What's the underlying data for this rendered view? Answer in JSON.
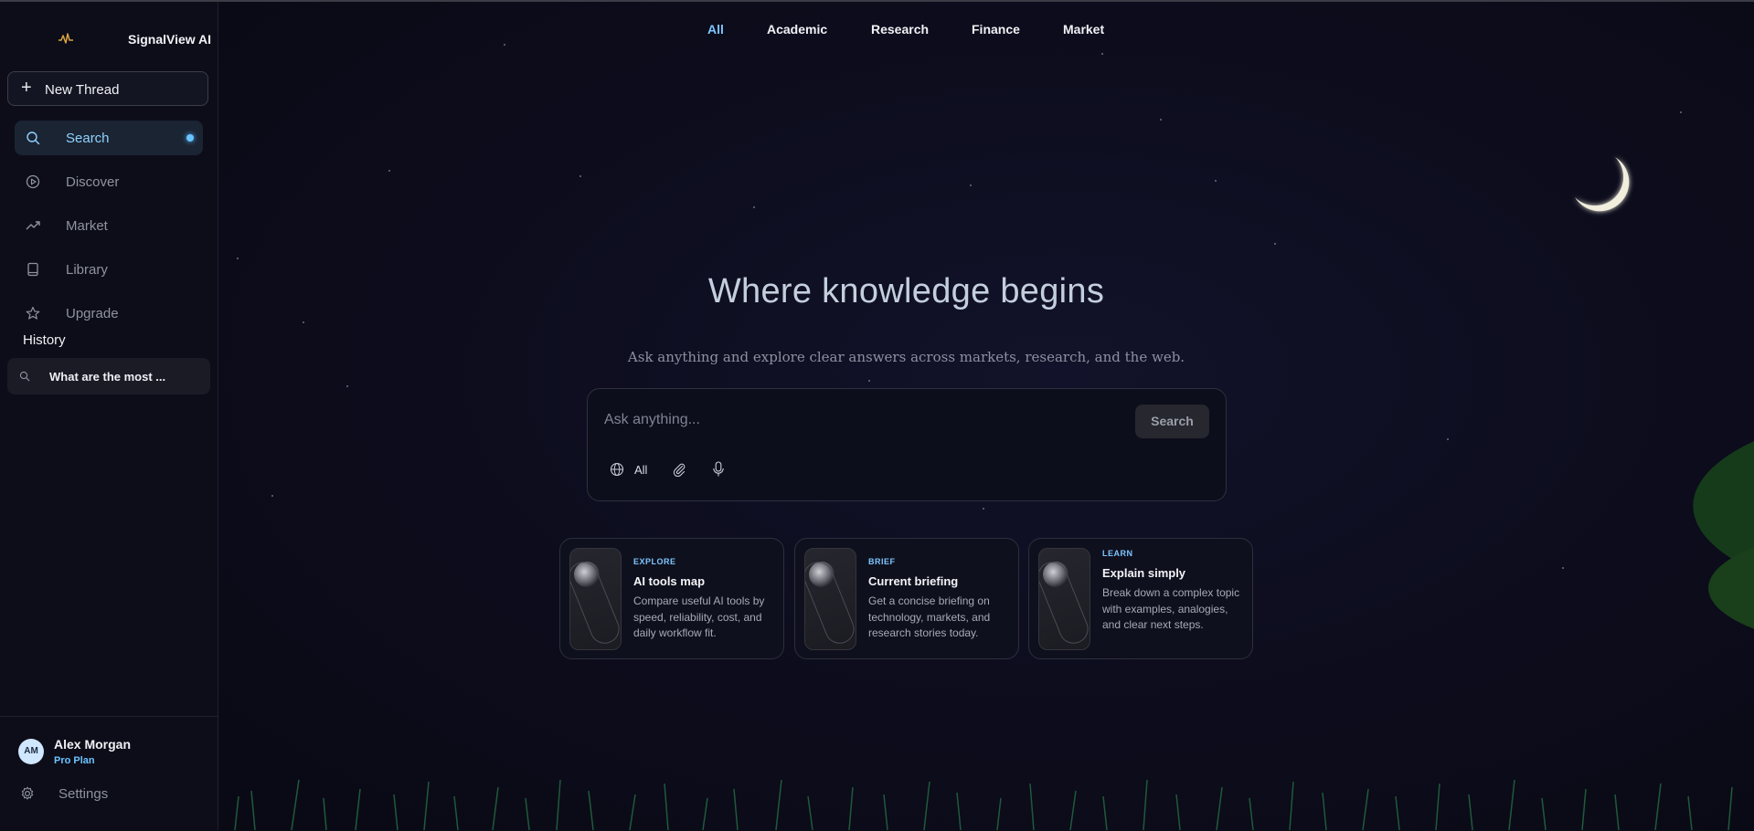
{
  "brand": {
    "name": "SignalView AI",
    "logo_icon": "pulse-icon",
    "accent": "#d9a640"
  },
  "sidebar": {
    "new_thread_label": "New Thread",
    "items": [
      {
        "label": "Search",
        "icon": "search-icon",
        "active": true
      },
      {
        "label": "Discover",
        "icon": "play-circle-icon"
      },
      {
        "label": "Market",
        "icon": "trending-up-icon"
      },
      {
        "label": "Library",
        "icon": "book-icon"
      },
      {
        "label": "Upgrade",
        "icon": "star-icon"
      }
    ],
    "history_title": "History",
    "history": [
      {
        "label": "What are the most ..."
      }
    ],
    "user": {
      "initials": "AM",
      "name": "Alex Morgan",
      "plan": "Pro Plan"
    },
    "settings_label": "Settings"
  },
  "tabs": [
    {
      "label": "All",
      "active": true
    },
    {
      "label": "Academic"
    },
    {
      "label": "Research"
    },
    {
      "label": "Finance"
    },
    {
      "label": "Market"
    }
  ],
  "hero": {
    "title": "Where knowledge begins",
    "subtitle": "Ask anything and explore clear answers across markets, research, and the web."
  },
  "search": {
    "placeholder": "Ask anything...",
    "button_label": "Search",
    "scope_label": "All"
  },
  "cards": [
    {
      "tag": "EXPLORE",
      "title": "AI tools map",
      "desc": "Compare useful AI tools by speed, reliability, cost, and daily workflow fit."
    },
    {
      "tag": "BRIEF",
      "title": "Current briefing",
      "desc": "Get a concise briefing on technology, markets, and research stories today."
    },
    {
      "tag": "LEARN",
      "title": "Explain simply",
      "desc": "Break down a complex topic with examples, analogies, and clear next steps."
    }
  ],
  "colors": {
    "accent": "#7cc6ff",
    "background": "#0c0c18"
  }
}
